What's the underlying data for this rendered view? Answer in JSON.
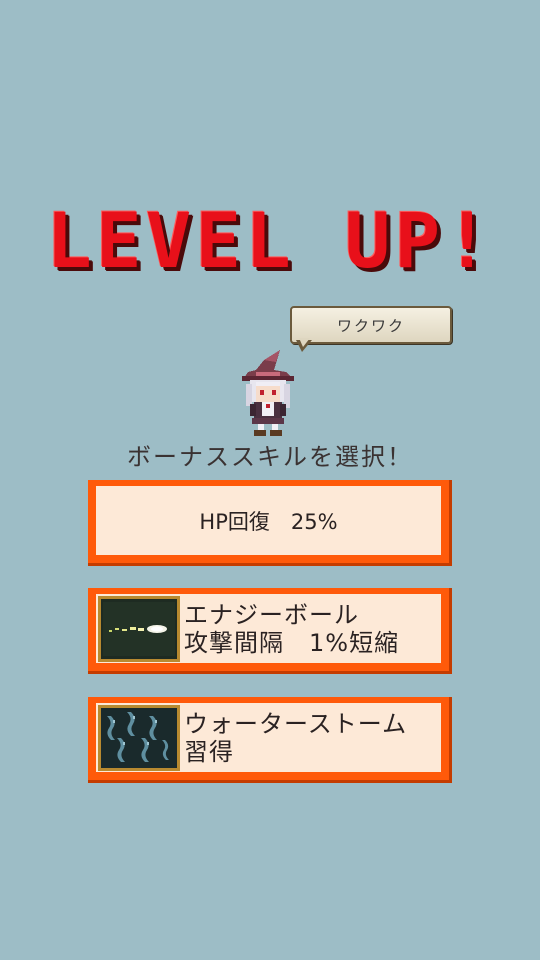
{
  "title": "LEVEL UP!",
  "speech_bubble": "ワクワク",
  "prompt": "ボーナススキルを選択！",
  "choices": [
    {
      "line1": "HP回復　25%"
    },
    {
      "line1": "エナジーボール",
      "line2": "攻撃間隔　1%短縮",
      "icon": "energy-ball-icon"
    },
    {
      "line1": "ウォーターストーム",
      "line2": "習得",
      "icon": "water-storm-icon"
    }
  ],
  "colors": {
    "background": "#9dbdc6",
    "title": "#e8101a",
    "choice_border": "#ff5a0a",
    "choice_fill": "#fde9d7"
  }
}
